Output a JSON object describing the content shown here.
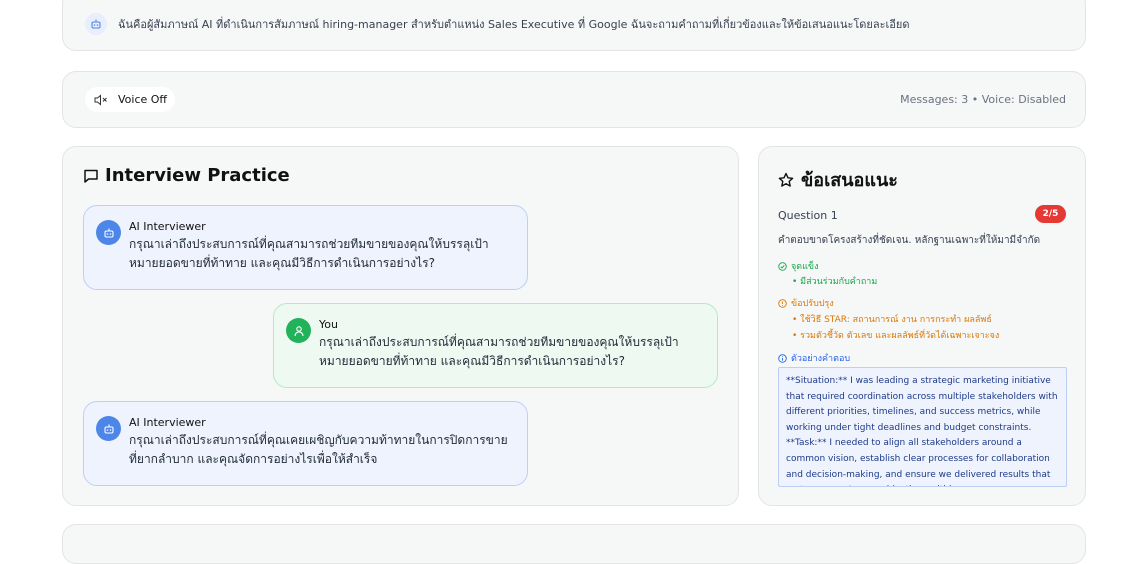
{
  "intro": {
    "text": "ฉันคือผู้สัมภาษณ์ AI ที่ดำเนินการสัมภาษณ์ hiring-manager สำหรับตำแหน่ง Sales Executive ที่ Google ฉันจะถามคำถามที่เกี่ยวข้องและให้ข้อเสนอแนะโดยละเอียด"
  },
  "voice": {
    "button_label": "Voice Off",
    "status": "Messages: 3 • Voice: Disabled"
  },
  "practice": {
    "title": "Interview Practice",
    "messages": [
      {
        "sender": "AI Interviewer",
        "text": "กรุณาเล่าถึงประสบการณ์ที่คุณสามารถช่วยทีมขายของคุณให้บรรลุเป้าหมายยอดขายที่ท้าทาย และคุณมีวิธีการดำเนินการอย่างไร?"
      },
      {
        "sender": "You",
        "text": "กรุณาเล่าถึงประสบการณ์ที่คุณสามารถช่วยทีมขายของคุณให้บรรลุเป้าหมายยอดขายที่ท้าทาย และคุณมีวิธีการดำเนินการอย่างไร?"
      },
      {
        "sender": "AI Interviewer",
        "text": "กรุณาเล่าถึงประสบการณ์ที่คุณเคยเผชิญกับความท้าทายในการปิดการขายที่ยากลำบาก และคุณจัดการอย่างไรเพื่อให้สำเร็จ"
      }
    ]
  },
  "suggestions": {
    "title": "ข้อเสนอแนะ",
    "question_label": "Question 1",
    "score": "2/5",
    "summary": "คำตอบขาดโครงสร้างที่ชัดเจน. หลักฐานเฉพาะที่ให้มามีจำกัด",
    "strengths_label": "จุดแข็ง",
    "strengths": [
      "• มีส่วนร่วมกับคำถาม"
    ],
    "improvements_label": "ข้อปรับปรุง",
    "improvements": [
      "• ใช้วิธี STAR: สถานการณ์ งาน การกระทำ ผลลัพธ์",
      "• รวมตัวชี้วัด ตัวเลข และผลลัพธ์ที่วัดได้เฉพาะเจาะจง"
    ],
    "example_label": "ตัวอย่างคำตอบ",
    "example_text": "**Situation:** I was leading a strategic marketing initiative that required coordination across multiple stakeholders with different priorities, timelines, and success metrics, while working under tight deadlines and budget constraints. **Task:** I needed to align all stakeholders around a common vision, establish clear processes for collaboration and decision-making, and ensure we delivered results that met everyone's core objectives within"
  }
}
